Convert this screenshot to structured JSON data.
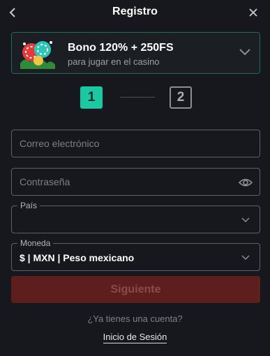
{
  "header": {
    "title": "Registro",
    "back_icon": "chevron-left-icon",
    "close_icon": "close-icon"
  },
  "bonus": {
    "title": "Bono 120% + 250FS",
    "subtitle": "para jugar en el casino",
    "image_icon": "casino-chips-bonus-icon",
    "chevron_icon": "chevron-down-icon",
    "border_color": "#1f6b55"
  },
  "stepper": {
    "steps": [
      "1",
      "2"
    ],
    "active_step": 1,
    "active_color": "#1ac8a1"
  },
  "form": {
    "email": {
      "placeholder": "Correo electrónico",
      "value": ""
    },
    "password": {
      "placeholder": "Contraseña",
      "value": "",
      "toggle_icon": "eye-icon"
    },
    "country": {
      "label": "País",
      "value": ""
    },
    "currency": {
      "label": "Moneda",
      "value": "$ | MXN | Peso mexicano"
    },
    "submit_label": "Siguiente",
    "submit_color": "#5c1f1d"
  },
  "footer": {
    "question": "¿Ya tienes una cuenta?",
    "login_label": "Inicio de Sesión"
  }
}
